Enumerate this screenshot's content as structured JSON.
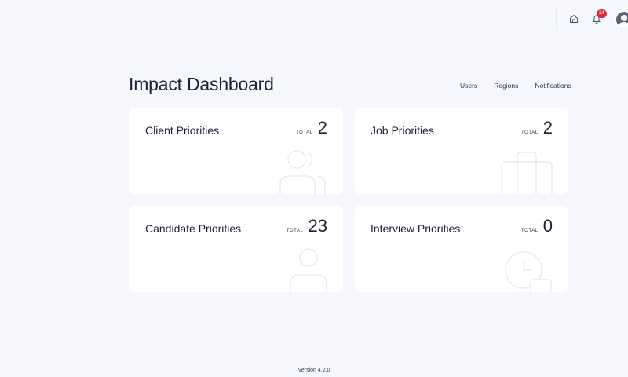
{
  "header": {
    "notification_count": "24",
    "home_icon": "home-icon",
    "bell_icon": "bell-icon",
    "avatar_icon": "user-avatar-icon"
  },
  "page": {
    "title": "Impact Dashboard",
    "nav": {
      "users": "Users",
      "regions": "Regions",
      "notifications": "Notifications"
    }
  },
  "cards": [
    {
      "title": "Client Priorities",
      "total_label": "TOTAL",
      "total": "2",
      "graphic": "users-group-icon"
    },
    {
      "title": "Job Priorities",
      "total_label": "TOTAL",
      "total": "2",
      "graphic": "briefcase-icon"
    },
    {
      "title": "Candidate Priorities",
      "total_label": "TOTAL",
      "total": "23",
      "graphic": "user-icon"
    },
    {
      "title": "Interview Priorities",
      "total_label": "TOTAL",
      "total": "0",
      "graphic": "clock-calendar-icon"
    }
  ],
  "footer": {
    "version": "Version 4.2.0"
  },
  "colors": {
    "background": "#f6f7fc",
    "card": "#ffffff",
    "badge": "#e0263f",
    "graphic_stroke": "#e3e6f0"
  }
}
